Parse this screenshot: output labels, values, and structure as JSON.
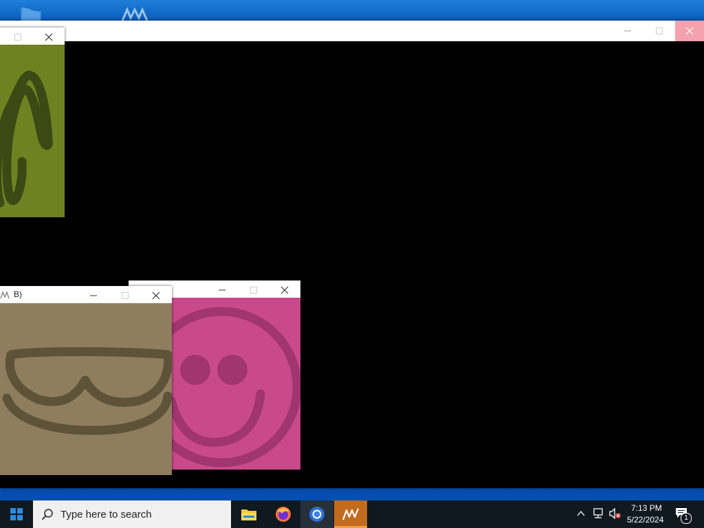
{
  "desktop": {
    "icons": [
      "folder-icon",
      "app-wave-icon"
    ]
  },
  "main_window": {
    "controls": [
      "minimize-icon",
      "maximize-icon",
      "close-icon"
    ],
    "close_hover_color": "#e81123"
  },
  "child_windows": [
    {
      "id": "olive",
      "title": "",
      "bg": "#6e8222",
      "stroke": "#3a4a14",
      "drawing": "scribble"
    },
    {
      "id": "pink",
      "title": "",
      "bg": "#c94a8a",
      "stroke": "#a03570",
      "drawing": "smiley"
    },
    {
      "id": "tan",
      "title": "B)",
      "bg": "#8f7d5e",
      "stroke": "#5e5238",
      "drawing": "sunglasses-smile"
    }
  ],
  "taskbar": {
    "search_placeholder": "Type here to search",
    "apps": [
      "file-explorer-icon",
      "firefox-icon",
      "chrome-icon",
      "wave-app-icon"
    ],
    "active_app_color": "#c26a1e",
    "clock_time": "7:13 PM",
    "clock_date": "5/22/2024",
    "notification_count": "1"
  }
}
